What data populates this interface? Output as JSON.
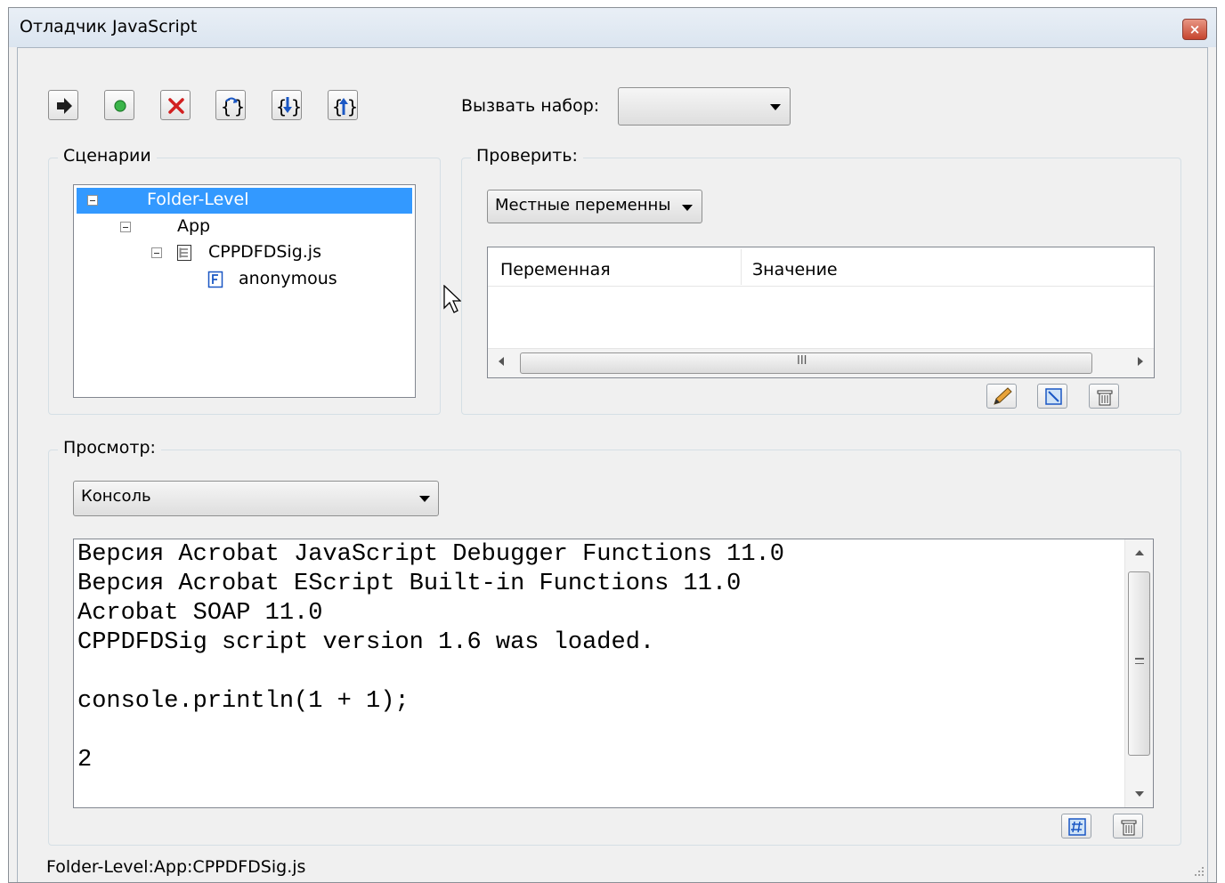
{
  "window": {
    "title": "Отладчик JavaScript",
    "close_symbol": "×"
  },
  "toolbar": {
    "buttons": [
      {
        "name": "resume-button",
        "icon": "arrow-right-icon"
      },
      {
        "name": "interrupt-button",
        "icon": "green-dot-icon"
      },
      {
        "name": "quit-button",
        "icon": "red-x-icon"
      },
      {
        "name": "step-over-button",
        "icon": "step-over-icon"
      },
      {
        "name": "step-into-button",
        "icon": "step-into-icon"
      },
      {
        "name": "step-out-button",
        "icon": "step-out-icon"
      }
    ],
    "call_stack_label": "Вызвать набор:",
    "call_stack_value": ""
  },
  "scripts": {
    "group_label": "Сценарии",
    "tree": [
      {
        "label": "Folder-Level",
        "selected": true
      },
      {
        "label": "App"
      },
      {
        "label": "CPPDFDSig.js"
      },
      {
        "label": "anonymous"
      }
    ]
  },
  "inspect": {
    "group_label": "Проверить:",
    "dropdown_value": "Местные переменные",
    "columns": [
      "Переменная",
      "Значение"
    ],
    "scroll_grip": "III",
    "rows": []
  },
  "view": {
    "group_label": "Просмотр:",
    "dropdown_value": "Консоль",
    "console_lines": [
      "Версия Acrobat JavaScript Debugger Functions 11.0",
      "Версия Acrobat EScript Built-in Functions 11.0",
      "Acrobat SOAP 11.0",
      "CPPDFDSig script version 1.6 was loaded.",
      "",
      "console.println(1 + 1);",
      "",
      "2"
    ]
  },
  "status": {
    "path": "Folder-Level:App:CPPDFDSig.js"
  },
  "colors": {
    "selection": "#3399ff",
    "title_bar": "#dbe5f0",
    "close_button": "#c6452f"
  }
}
